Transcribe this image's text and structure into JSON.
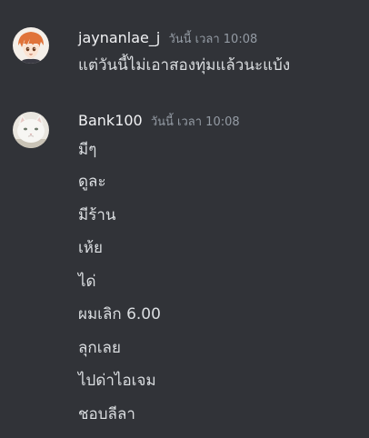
{
  "messages": [
    {
      "username": "jaynanlae_j",
      "timestamp": "วันนี้ เวลา 10:08",
      "avatar_icon": "anime-boy-avatar-icon",
      "lines": [
        "แต่วันนี้ไม่เอาสองทุ่มแล้วนะแบ้ง"
      ]
    },
    {
      "username": "Bank100",
      "timestamp": "วันนี้ เวลา 10:08",
      "avatar_icon": "white-cat-avatar-icon",
      "lines": [
        "มีๆ",
        "ดูละ",
        "มีร้าน",
        "เห้ย",
        "ได่",
        "ผมเลิก 6.00",
        "ลุกเลย",
        "ไปด่าไอเจม",
        "ชอบลีลา"
      ]
    }
  ],
  "colors": {
    "background": "#313338",
    "username": "#f2f3f5",
    "timestamp": "#949ba4",
    "message_text": "#dbdee1"
  }
}
